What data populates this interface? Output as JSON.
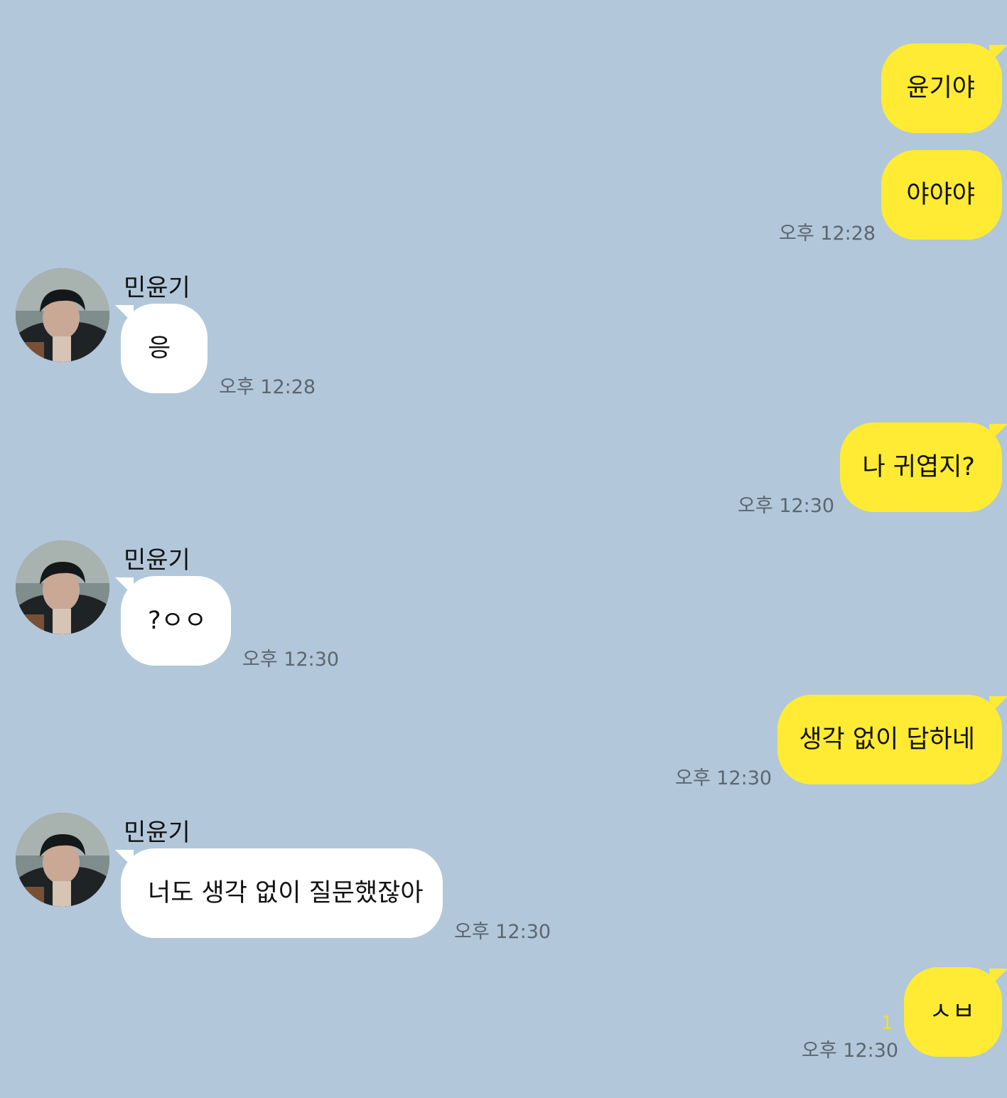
{
  "chat": {
    "sender_name": "민윤기",
    "messages": [
      {
        "from": "me",
        "text": "윤기야"
      },
      {
        "from": "me",
        "text": "야야야",
        "time": "오후 12:28"
      },
      {
        "from": "other",
        "text": "응",
        "time": "오후 12:28"
      },
      {
        "from": "me",
        "text": "나 귀엽지?",
        "time": "오후 12:30"
      },
      {
        "from": "other",
        "text": "?ㅇㅇ",
        "time": "오후 12:30"
      },
      {
        "from": "me",
        "text": "생각 없이 답하네",
        "time": "오후 12:30"
      },
      {
        "from": "other",
        "text": "너도 생각 없이 질문했잖아",
        "time": "오후 12:30"
      },
      {
        "from": "me",
        "text": "ㅅㅂ",
        "time": "오후 12:30",
        "unread": "1"
      }
    ]
  },
  "colors": {
    "background": "#b2c7da",
    "my_bubble": "#ffeb33",
    "other_bubble": "#ffffff",
    "timestamp": "#5b6670",
    "unread": "#f1dd3b"
  },
  "icons": {
    "avatar": "profile-photo"
  }
}
